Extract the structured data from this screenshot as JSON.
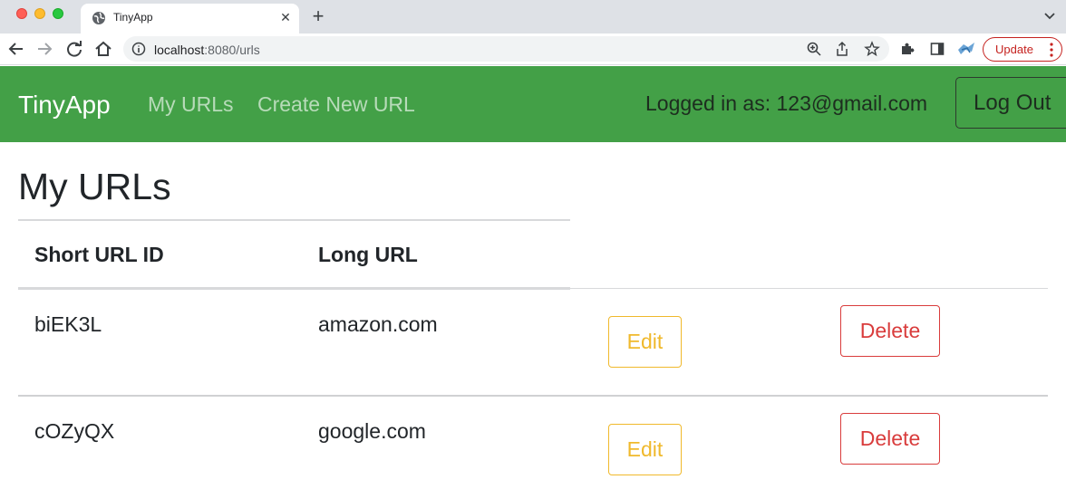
{
  "browser": {
    "tab_title": "TinyApp",
    "url_host": "localhost",
    "url_rest": ":8080/urls",
    "update_label": "Update"
  },
  "navbar": {
    "brand": "TinyApp",
    "links": [
      "My URLs",
      "Create New URL"
    ],
    "logged_in_text": "Logged in as: 123@gmail.com",
    "logout_label": "Log Out",
    "background": "#43a047"
  },
  "main": {
    "title": "My URLs",
    "columns": [
      "Short URL ID",
      "Long URL"
    ],
    "rows": [
      {
        "short_id": "biEK3L",
        "long_url": "amazon.com",
        "edit_label": "Edit",
        "delete_label": "Delete"
      },
      {
        "short_id": "cOZyQX",
        "long_url": "google.com",
        "edit_label": "Edit",
        "delete_label": "Delete"
      }
    ]
  }
}
